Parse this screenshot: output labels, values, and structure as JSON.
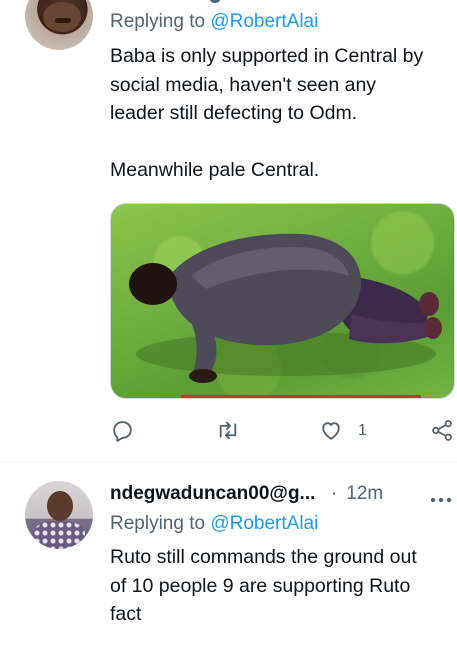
{
  "tweet1": {
    "replying_prefix": "Replying to ",
    "replying_handle": "@RobertAlai",
    "text_lines": [
      "Baba is only supported in Central by",
      "social media, haven't seen any",
      "leader still defecting to Odm.",
      "Meanwhile pale Central."
    ],
    "actions": {
      "like_count": "1"
    }
  },
  "tweet2": {
    "author": "ndegwaduncan00@g...",
    "separator": "·",
    "time": "12m",
    "replying_prefix": "Replying to ",
    "replying_handle": "@RobertAlai",
    "text_lines": [
      "Ruto still commands the ground out",
      "of 10 people 9 are supporting Ruto",
      "fact"
    ]
  },
  "icons": {
    "reply": "comment-icon",
    "retweet": "retweet-icon",
    "like": "heart-icon",
    "share": "share-icon",
    "more": "more-icon"
  },
  "colors": {
    "accent": "#1d9bf0",
    "secondary_text": "#536471",
    "primary_text": "#0f1419"
  }
}
